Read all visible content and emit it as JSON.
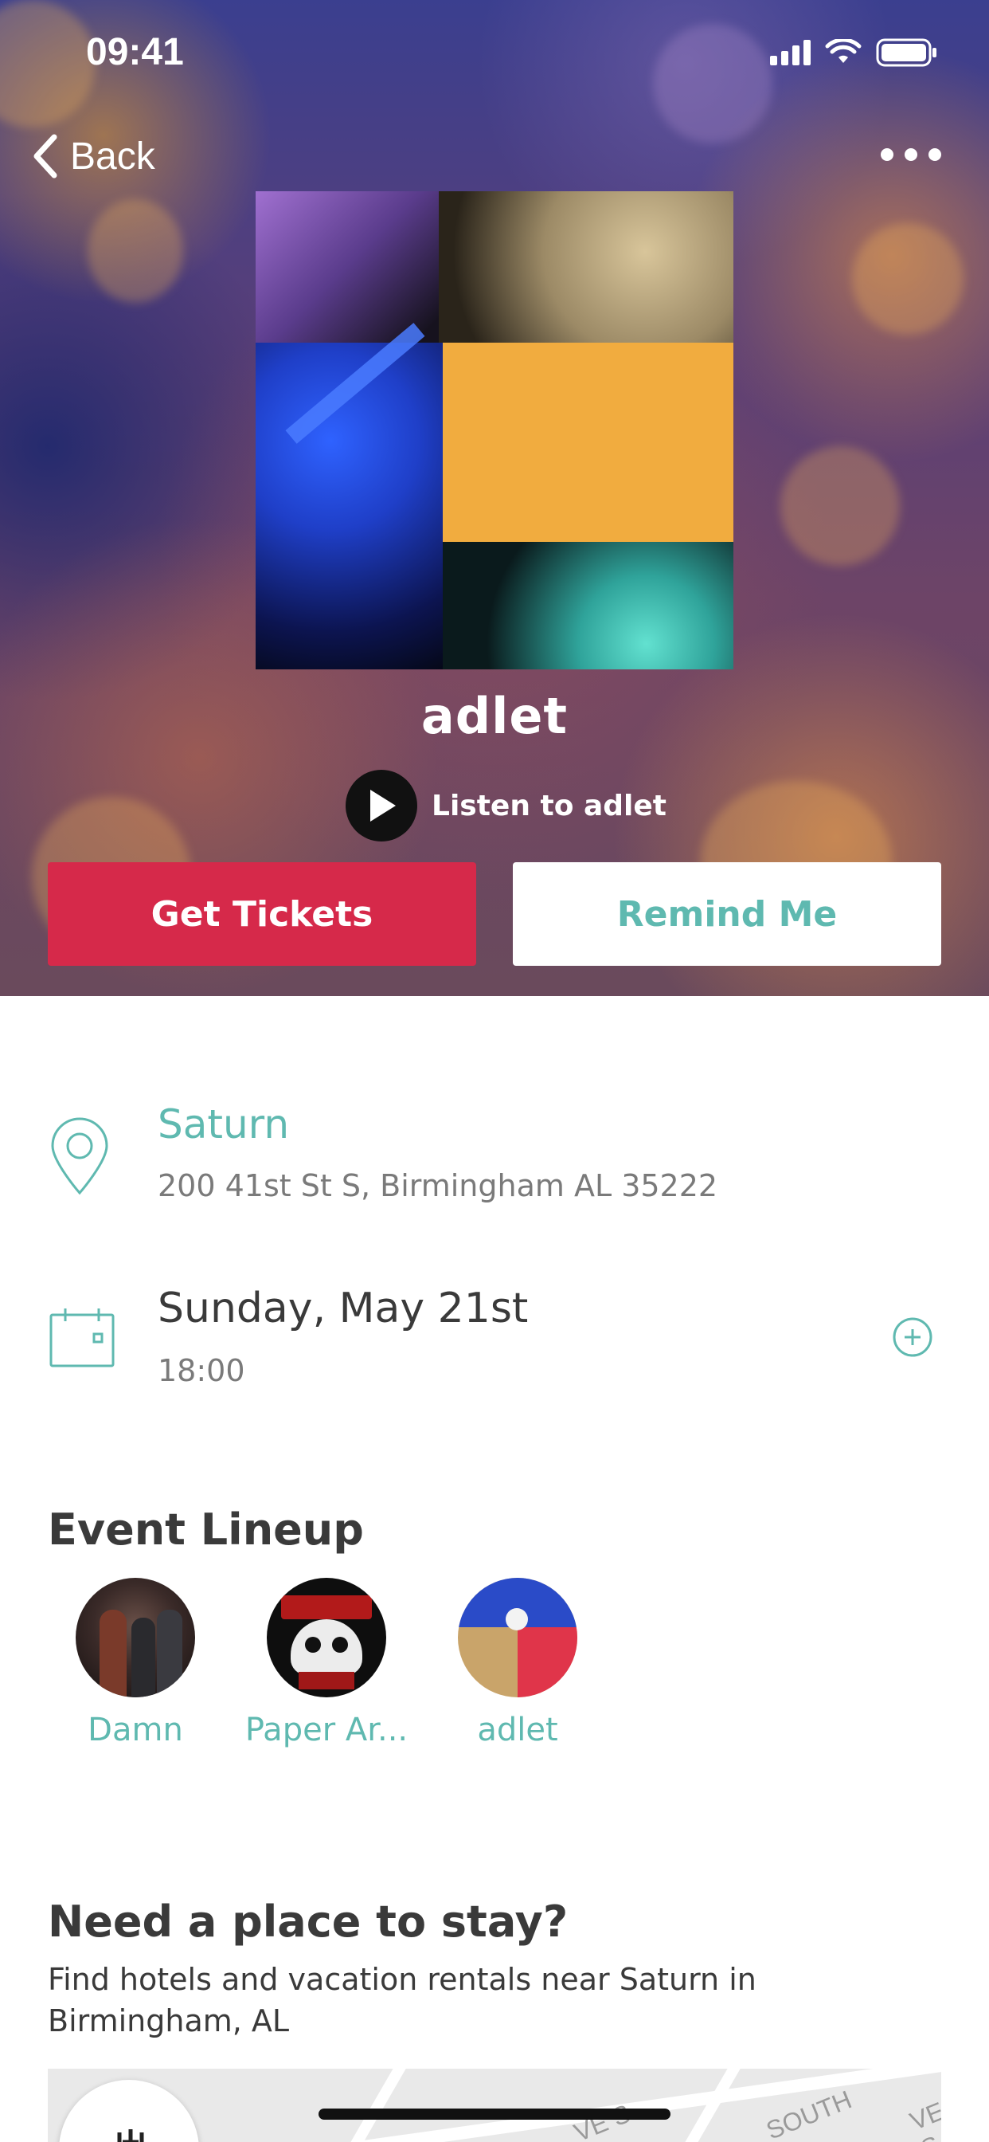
{
  "status_bar": {
    "time": "09:41"
  },
  "nav": {
    "back_label": "Back"
  },
  "artist": {
    "name": "adlet",
    "listen_label": "Listen to adlet"
  },
  "actions": {
    "tickets_label": "Get Tickets",
    "remind_label": "Remind Me"
  },
  "venue": {
    "name": "Saturn",
    "address": "200 41st St S, Birmingham AL 35222"
  },
  "event": {
    "date": "Sunday, May 21st",
    "time": "18:00"
  },
  "lineup": {
    "title": "Event Lineup",
    "artists": [
      {
        "name": "Damn"
      },
      {
        "name": "Paper Ar..."
      },
      {
        "name": "adlet"
      }
    ]
  },
  "stay": {
    "title": "Need a place to stay?",
    "description": "Find hotels and vacation rentals near Saturn in Birmingham, AL"
  },
  "map": {
    "labels": [
      "VE S",
      "SOUTH",
      "VE S"
    ]
  },
  "colors": {
    "accent": "#5fb9b0",
    "tickets": "#d6294a",
    "text": "#3a3a3a",
    "muted": "#7a7a7a"
  },
  "icons": [
    "back-chevron-icon",
    "more-icon",
    "location-pin-icon",
    "calendar-icon",
    "add-circle-icon",
    "play-icon",
    "signal-icon",
    "wifi-icon",
    "battery-icon"
  ]
}
